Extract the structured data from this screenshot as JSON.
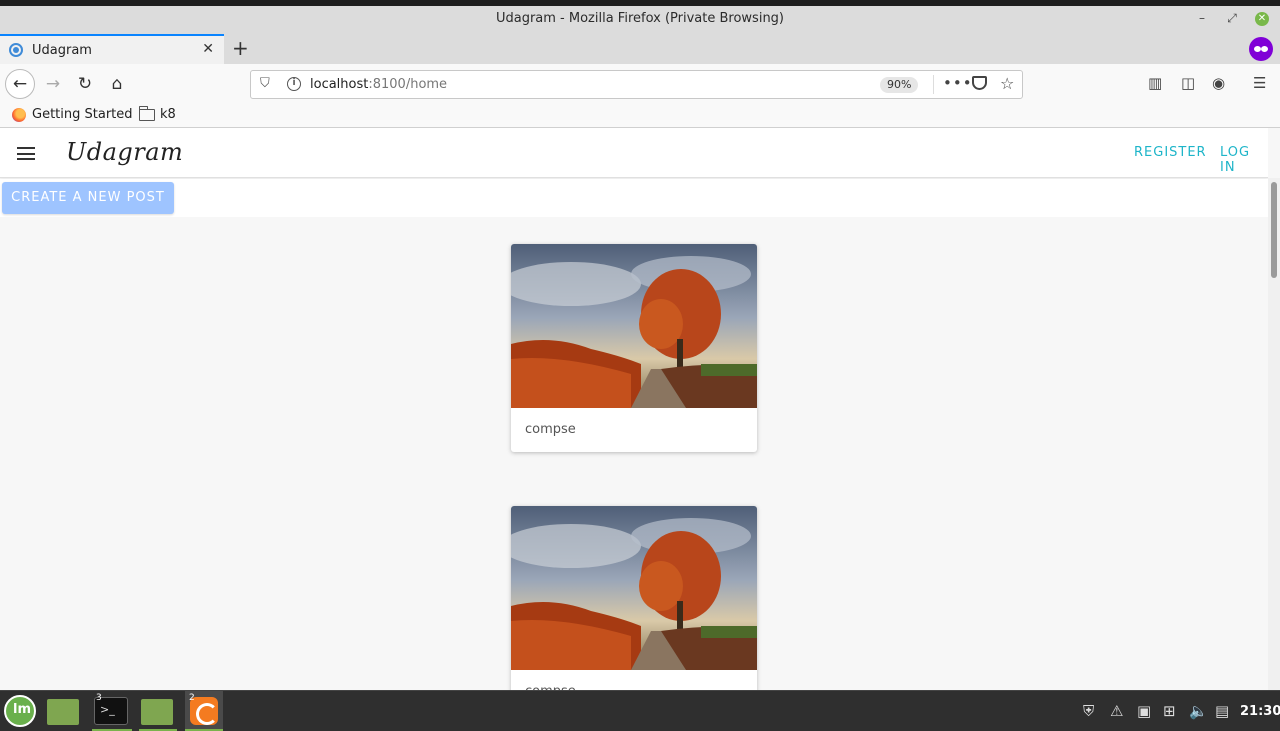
{
  "window": {
    "title": "Udagram - Mozilla Firefox (Private Browsing)",
    "minimize_icon": "minimize-icon",
    "maximize_icon": "maximize-icon",
    "close_icon": "close-icon"
  },
  "tabs": [
    {
      "label": "Udagram",
      "active": true
    }
  ],
  "address_bar": {
    "host": "localhost",
    "path": ":8100/home",
    "zoom": "90%"
  },
  "bookmarks": [
    {
      "label": "Getting Started",
      "icon": "firefox-icon"
    },
    {
      "label": "k8",
      "icon": "folder-icon"
    }
  ],
  "app": {
    "brand": "Udagram",
    "register_label": "REGISTER",
    "login_label": "LOG IN",
    "create_post_label": "CREATE A NEW POST",
    "accent_color": "#1eb5c9",
    "button_color": "#9ec4ff"
  },
  "feed": [
    {
      "caption": "compse"
    },
    {
      "caption": "compse"
    }
  ],
  "taskbar": {
    "terminal_badge": "3",
    "firefox_badge": "2",
    "clock": "21:30"
  }
}
